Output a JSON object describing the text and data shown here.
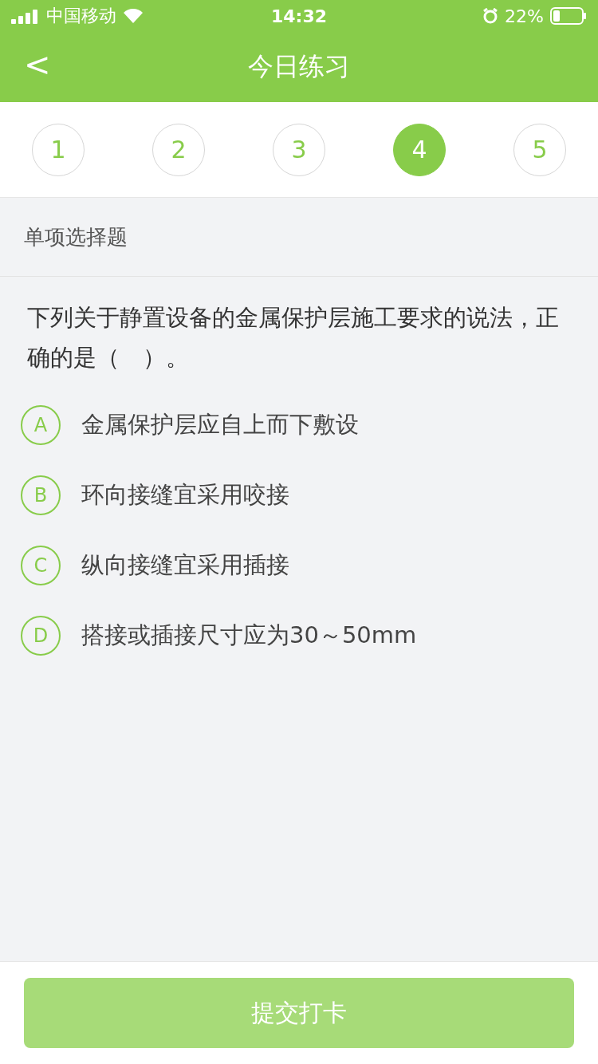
{
  "status_bar": {
    "carrier": "中国移动",
    "time": "14:32",
    "battery": "22%"
  },
  "header": {
    "back": "<",
    "title": "今日练习"
  },
  "steps": [
    {
      "label": "1",
      "selected": false
    },
    {
      "label": "2",
      "selected": false
    },
    {
      "label": "3",
      "selected": false
    },
    {
      "label": "4",
      "selected": true
    },
    {
      "label": "5",
      "selected": false
    }
  ],
  "section": "单项选择题",
  "question": "下列关于静置设备的金属保护层施工要求的说法，正确的是（　）。",
  "options": [
    {
      "letter": "A",
      "text": "金属保护层应自上而下敷设",
      "selected": false
    },
    {
      "letter": "B",
      "text": "环向接缝宜采用咬接",
      "selected": false
    },
    {
      "letter": "C",
      "text": "纵向接缝宜采用插接",
      "selected": false
    },
    {
      "letter": "D",
      "text": "搭接或插接尺寸应为30～50mm",
      "selected": false
    }
  ],
  "submit": "提交打卡"
}
